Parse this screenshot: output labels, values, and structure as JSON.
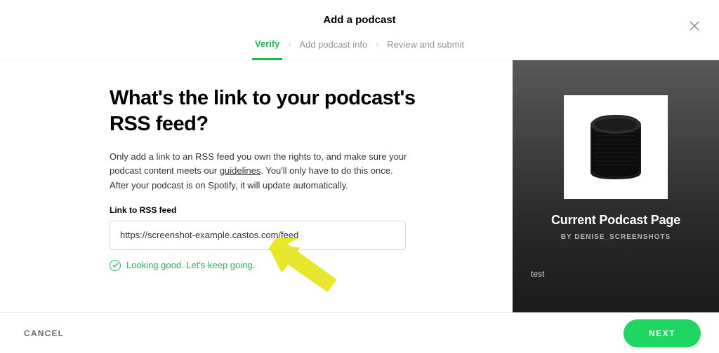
{
  "header": {
    "title": "Add a podcast"
  },
  "steps": [
    {
      "label": "Verify",
      "active": true
    },
    {
      "label": "Add podcast info",
      "active": false
    },
    {
      "label": "Review and submit",
      "active": false
    }
  ],
  "main": {
    "heading": "What's the link to your podcast's RSS feed?",
    "description_pre": "Only add a link to an RSS feed you own the rights to, and make sure your podcast content meets our ",
    "guidelines_link_text": "guidelines",
    "description_post": ". You'll only have to do this once. After your podcast is on Spotify, it will update automatically.",
    "input_label": "Link to RSS feed",
    "input_value": "https://screenshot-example.castos.com/feed",
    "validation_message": "Looking good. Let's keep going."
  },
  "preview": {
    "title": "Current Podcast Page",
    "author": "BY DENISE_SCREENSHOTS",
    "note": "test"
  },
  "footer": {
    "cancel": "CANCEL",
    "next": "NEXT"
  },
  "colors": {
    "accent": "#1db954"
  }
}
